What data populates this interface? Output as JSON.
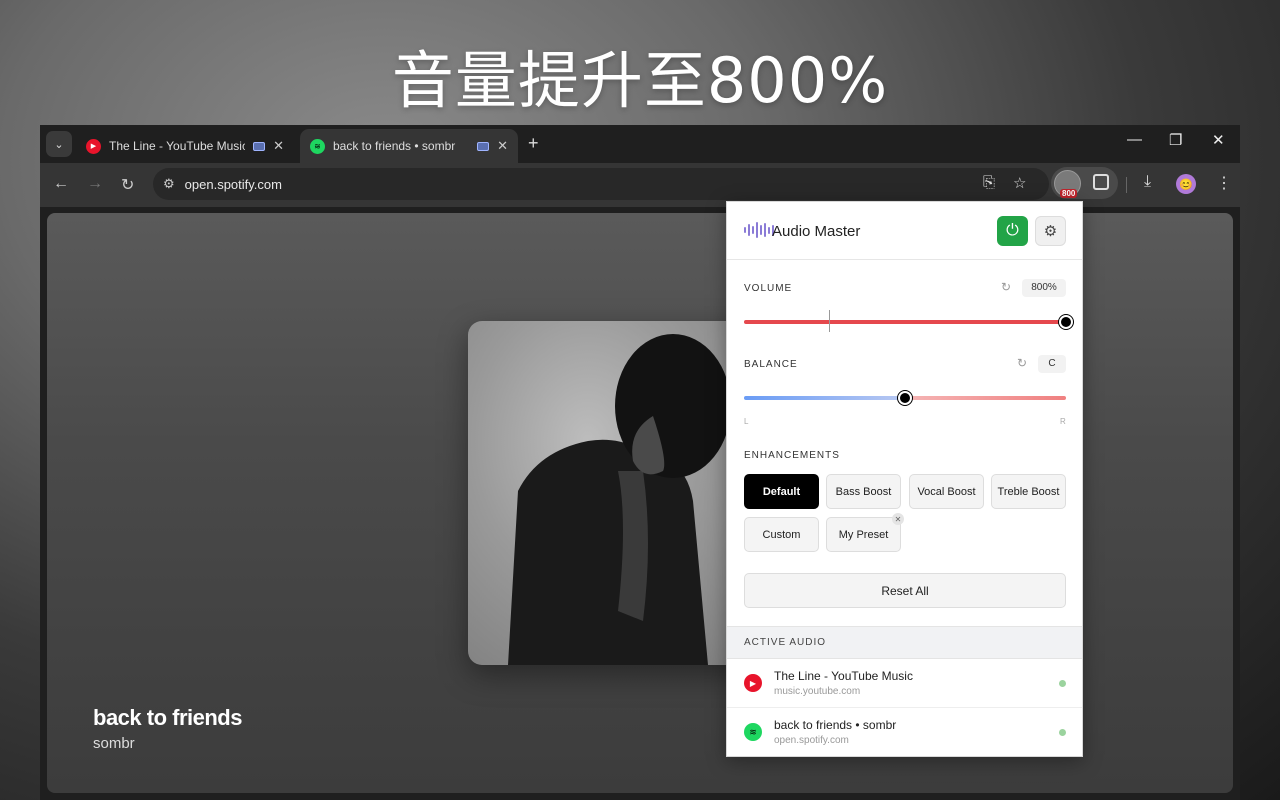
{
  "headline": "音量提升至800%",
  "tabs": [
    {
      "title": "The Line - YouTube Music",
      "icon": "youtube-music-icon"
    },
    {
      "title": "back to friends • sombr",
      "icon": "spotify-icon"
    }
  ],
  "address": "open.spotify.com",
  "extension_badge": "800",
  "now_playing": {
    "song": "back to friends",
    "artist": "sombr"
  },
  "popup": {
    "title": "Audio Master",
    "volume": {
      "label": "VOLUME",
      "value": "800%",
      "level": 1.0,
      "marker": 0.265
    },
    "balance": {
      "label": "BALANCE",
      "value": "C",
      "position": 0.5,
      "left": "L",
      "right": "R"
    },
    "enhancements_label": "ENHANCEMENTS",
    "presets": [
      "Default",
      "Bass Boost",
      "Vocal Boost",
      "Treble Boost",
      "Custom",
      "My Preset"
    ],
    "active_preset": "Default",
    "reset_all": "Reset All",
    "active_audio_label": "ACTIVE AUDIO",
    "active_audio": [
      {
        "title": "The Line - YouTube Music",
        "url": "music.youtube.com",
        "icon": "youtube-music-icon"
      },
      {
        "title": "back to friends • sombr",
        "url": "open.spotify.com",
        "icon": "spotify-icon"
      }
    ]
  },
  "colors": {
    "power": "#22a447",
    "volume": "#e5484d",
    "balance_left": "#6a9cf5",
    "balance_right": "#f08080",
    "youtube": "#e8142b",
    "spotify": "#1ed760"
  }
}
